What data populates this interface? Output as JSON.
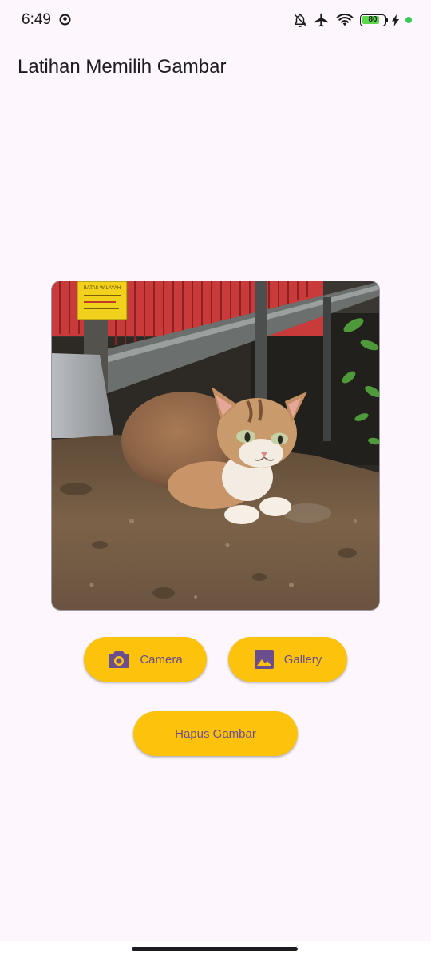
{
  "colors": {
    "background": "#fdf7fd",
    "button_bg": "#fdc20c",
    "button_fg": "#6a4e8e",
    "battery_fill": "#5bd94a",
    "charging_dot": "#35c955"
  },
  "status_bar": {
    "time": "6:49",
    "left_icon": "sync-circle-icon",
    "battery_level": "80",
    "battery_fraction": 0.8,
    "icons": [
      "bell-off-icon",
      "airplane-icon",
      "wifi-icon",
      "battery-icon",
      "charging-bolt-icon",
      "status-dot-icon"
    ]
  },
  "app_bar": {
    "title": "Latihan Memilih Gambar"
  },
  "image_preview": {
    "subject": "cat photo",
    "sign_text": "BATAS WILAYAH"
  },
  "buttons": {
    "camera": {
      "label": "Camera",
      "icon": "camera-icon"
    },
    "gallery": {
      "label": "Gallery",
      "icon": "image-icon"
    },
    "clear": {
      "label": "Hapus Gambar"
    }
  }
}
